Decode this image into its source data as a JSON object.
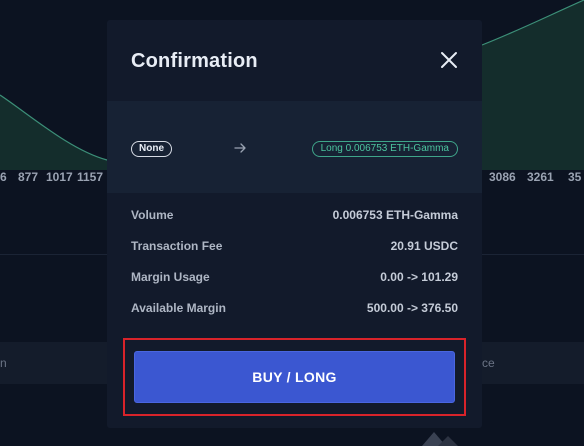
{
  "background": {
    "axis_ticks_left": [
      "6",
      "877",
      "1017",
      "1157"
    ],
    "axis_ticks_right": [
      "3086",
      "3261",
      "35"
    ],
    "stripe_left_text": "n",
    "stripe_right_text": "ce"
  },
  "modal": {
    "title": "Confirmation",
    "close_icon": "close-icon",
    "from_badge": "None",
    "arrow_icon": "arrow-right-icon",
    "to_badge": "Long 0.006753 ETH-Gamma",
    "details": [
      {
        "label": "Volume",
        "value": "0.006753 ETH-Gamma"
      },
      {
        "label": "Transaction Fee",
        "value": "20.91 USDC"
      },
      {
        "label": "Margin Usage",
        "value": "0.00 -> 101.29"
      },
      {
        "label": "Available Margin",
        "value": "500.00 -> 376.50"
      }
    ],
    "confirm_button": "BUY / LONG"
  },
  "colors": {
    "accent_button": "#3b57d1",
    "long_green": "#4cc59f",
    "highlight_red": "#d8232a",
    "modal_bg": "#121a2b"
  }
}
